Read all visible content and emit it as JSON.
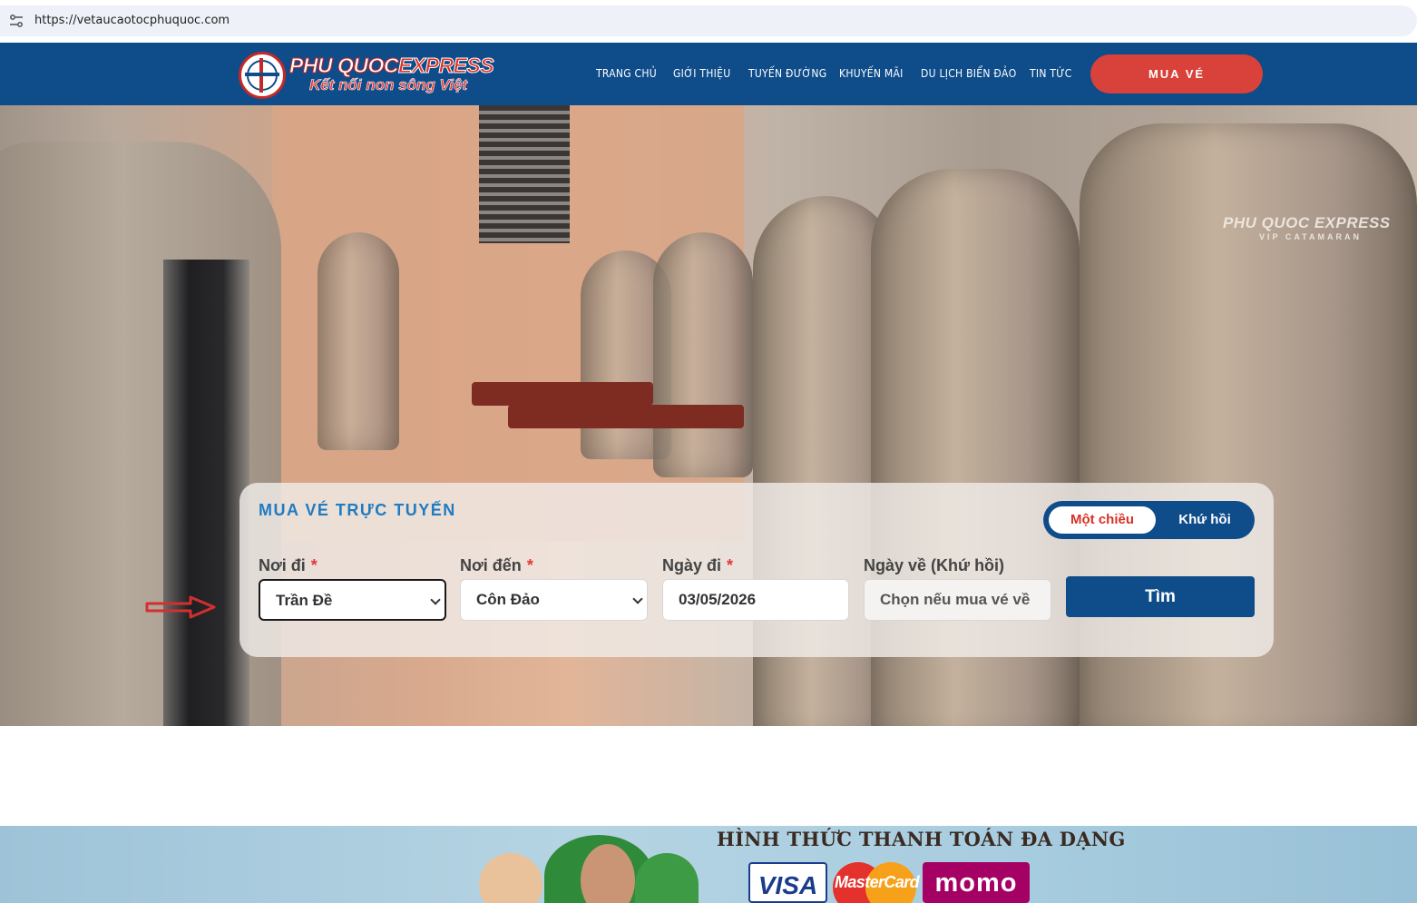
{
  "browser": {
    "url": "https://vetaucaotocphuquoc.com"
  },
  "nav": {
    "brand": "PHU QUOC",
    "brand_accent": "EXPRESS",
    "tagline": "Kết nối non sông Việt",
    "items": [
      "TRANG CHỦ",
      "GIỚI THIỆU",
      "TUYẾN ĐƯỜNG",
      "KHUYẾN MÃI",
      "DU LỊCH BIỂN ĐẢO",
      "TIN TỨC"
    ],
    "cta": "MUA VÉ",
    "colors": {
      "bar": "#0f4c8a",
      "cta": "#d9423a"
    }
  },
  "hero": {
    "seat_brand": "PHU QUOC EXPRESS",
    "seat_sub": "VIP CATAMARAN"
  },
  "booking": {
    "title": "MUA VÉ TRỰC TUYẾN",
    "trip_type": {
      "one_way": "Một chiều",
      "round_trip": "Khứ hồi",
      "selected": "one_way"
    },
    "fields": {
      "from": {
        "label": "Nơi đi",
        "required": "*",
        "value": "Trần Đề"
      },
      "to": {
        "label": "Nơi đến",
        "required": "*",
        "value": "Côn Đảo"
      },
      "depart": {
        "label": "Ngày đi",
        "required": "*",
        "value": "03/05/2026"
      },
      "return": {
        "label": "Ngày về (Khứ hồi)",
        "placeholder": "Chọn nếu mua vé về"
      }
    },
    "search_label": "Tìm"
  },
  "payment": {
    "heading": "HÌNH THỨC THANH TOÁN ĐA DẠNG",
    "methods": [
      "VISA",
      "MasterCard",
      "momo"
    ]
  }
}
